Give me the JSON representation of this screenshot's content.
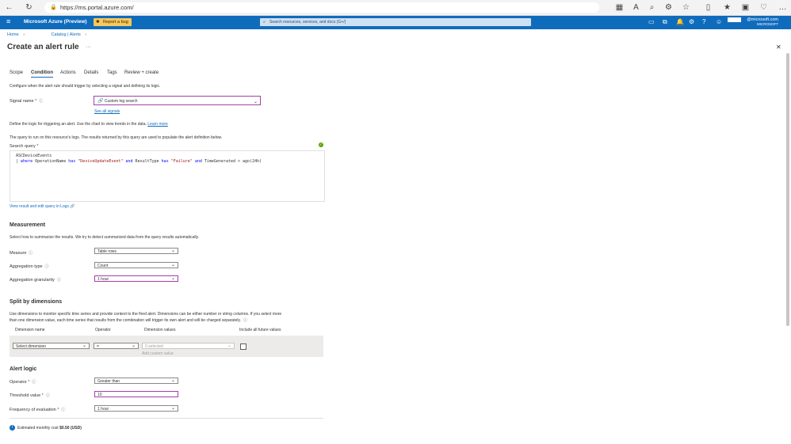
{
  "browser": {
    "url": "https://ms.portal.azure.com/"
  },
  "azure": {
    "brand": "Microsoft Azure (Preview)",
    "report_bug": "Report a bug",
    "search_placeholder": "Search resources, services, and docs (G+/)",
    "account": "@microsoft.com",
    "tenant": "MICROSOFT"
  },
  "breadcrumb": {
    "home": "Home",
    "catalog": "Catalog | Alerts"
  },
  "page": {
    "title": "Create an alert rule",
    "more": "···",
    "close": "✕"
  },
  "tabs": [
    "Scope",
    "Condition",
    "Actions",
    "Details",
    "Tags",
    "Review + create"
  ],
  "condition": {
    "intro": "Configure when the alert rule should trigger by selecting a signal and defining its logic.",
    "signal_label": "Signal name",
    "signal_value": "Custom log search",
    "see_all": "See all signals",
    "define": "Define the logic for triggering an alert. Use the chart to view trends in the data.",
    "learn_more": "Learn more",
    "query_desc": "The query to run on this resource's logs. The results returned by this query are used to populate the alert definition below.",
    "query_label": "Search query",
    "query_line1": "ASCDeviceEvents",
    "query_pipe": "| ",
    "q_where": "where",
    "q_a": " OperationName ",
    "q_has1": "has",
    "q_str1": " \"DeviceUpdateEvent\"",
    "q_and1": " and",
    "q_b": " ResultType ",
    "q_has2": "has",
    "q_str2": " \"Failure\"",
    "q_and2": " and",
    "q_c": " TimeGenerated > ago(24h)",
    "view_logs": "View result and edit query in Logs"
  },
  "measurement": {
    "heading": "Measurement",
    "desc": "Select how to summarize the results. We try to detect summarized data from the query results automatically.",
    "measure_label": "Measure",
    "measure_value": "Table rows",
    "agg_type_label": "Aggregation type",
    "agg_type_value": "Count",
    "agg_gran_label": "Aggregation granularity",
    "agg_gran_value": "1 hour"
  },
  "split": {
    "heading": "Split by dimensions",
    "desc1": "Use dimensions to monitor specific time series and provide context to the fired alert. Dimensions can be either number or string columns. If you select more",
    "desc2": "than one dimension value, each time series that results from the combination will trigger its own alert and will be charged separately.",
    "col_name": "Dimension name",
    "col_operator": "Operator",
    "col_values": "Dimension values",
    "col_future": "Include all future values",
    "dim_select": "Select dimension",
    "op_value": "=",
    "values_placeholder": "0 selected",
    "add_custom": "Add custom value"
  },
  "alert_logic": {
    "heading": "Alert logic",
    "operator_label": "Operator",
    "operator_value": "Greater than",
    "threshold_label": "Threshold value",
    "threshold_value": "10",
    "frequency_label": "Frequency of evaluation",
    "frequency_value": "1 hour"
  },
  "cost": {
    "label": "Estimated monthly cost",
    "value": "$0.50 (USD)"
  }
}
